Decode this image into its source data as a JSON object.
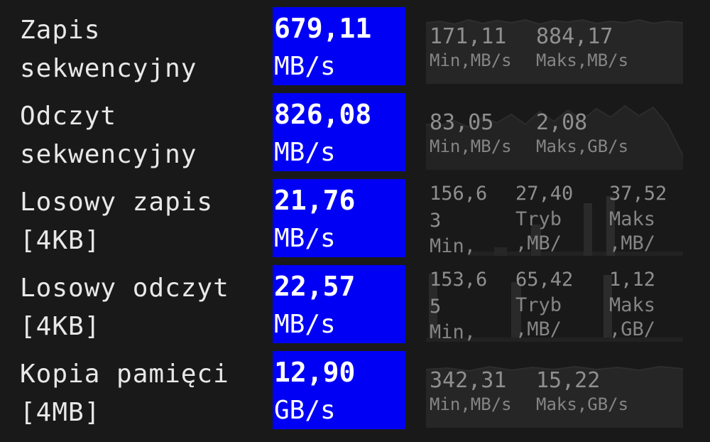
{
  "rows": [
    {
      "label": "Zapis\nsekwencyjny",
      "value": "679,11",
      "unit": "MB/s",
      "min_value": "171,11",
      "min_label": "Min,MB/s",
      "max_value": "884,17",
      "max_label": "Maks,MB/s"
    },
    {
      "label": "Odczyt\nsekwencyjny",
      "value": "826,08",
      "unit": "MB/s",
      "min_value": "83,05",
      "min_label": "Min,MB/s",
      "max_value": "2,08",
      "max_label": "Maks,GB/s"
    },
    {
      "label": "Losowy zapis\n[4KB]",
      "value": "21,76",
      "unit": "MB/s",
      "min_value": "156,6\n3",
      "min_label": "Min,",
      "mode_value": "27,40",
      "mode_label": "Tryb\n,MB/",
      "max_value": "37,52",
      "max_label": "Maks\n,MB/"
    },
    {
      "label": "Losowy odczyt\n[4KB]",
      "value": "22,57",
      "unit": "MB/s",
      "min_value": "153,6\n5",
      "min_label": "Min,",
      "mode_value": "65,42",
      "mode_label": "Tryb\n,MB/",
      "max_value": "1,12",
      "max_label": "Maks\n,GB/"
    },
    {
      "label": "Kopia pamięci\n[4MB]",
      "value": "12,90",
      "unit": "GB/s",
      "min_value": "342,31",
      "min_label": "Min,MB/s",
      "max_value": "15,22",
      "max_label": "Maks,GB/s"
    }
  ],
  "colors": {
    "background": "#191919",
    "value_box": "#0000f5",
    "value_text": "#ffffff",
    "stat_text": "#8a8a8a",
    "graph": "#2a2a2a"
  }
}
